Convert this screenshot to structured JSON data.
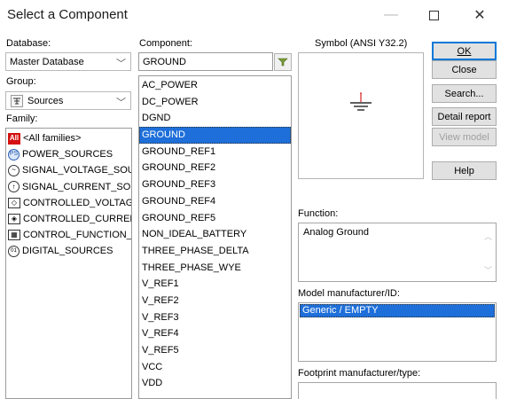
{
  "window": {
    "title": "Select a Component"
  },
  "database": {
    "label": "Database:",
    "value": "Master Database"
  },
  "group": {
    "label": "Group:",
    "value": "Sources"
  },
  "family": {
    "label": "Family:",
    "items": [
      {
        "label": "<All families>",
        "icon": "all-families-icon"
      },
      {
        "label": "POWER_SOURCES",
        "icon": "power-sources-icon"
      },
      {
        "label": "SIGNAL_VOLTAGE_SOU",
        "icon": "signal-voltage-icon"
      },
      {
        "label": "SIGNAL_CURRENT_SOU",
        "icon": "signal-current-icon"
      },
      {
        "label": "CONTROLLED_VOLTAGE",
        "icon": "controlled-voltage-icon"
      },
      {
        "label": "CONTROLLED_CURRENT",
        "icon": "controlled-current-icon"
      },
      {
        "label": "CONTROL_FUNCTION_E",
        "icon": "control-function-icon"
      },
      {
        "label": "DIGITAL_SOURCES",
        "icon": "digital-sources-icon"
      }
    ]
  },
  "component": {
    "label": "Component:",
    "search_value": "GROUND",
    "selected": "GROUND",
    "items": [
      "AC_POWER",
      "DC_POWER",
      "DGND",
      "GROUND",
      "GROUND_REF1",
      "GROUND_REF2",
      "GROUND_REF3",
      "GROUND_REF4",
      "GROUND_REF5",
      "NON_IDEAL_BATTERY",
      "THREE_PHASE_DELTA",
      "THREE_PHASE_WYE",
      "V_REF1",
      "V_REF2",
      "V_REF3",
      "V_REF4",
      "V_REF5",
      "VCC",
      "VDD"
    ]
  },
  "symbol": {
    "label": "Symbol (ANSI Y32.2)"
  },
  "buttons": {
    "ok": "OK",
    "close": "Close",
    "search": "Search...",
    "detail_report": "Detail report",
    "view_model": "View model",
    "help": "Help"
  },
  "function": {
    "label": "Function:",
    "value": "Analog Ground"
  },
  "model_manufacturer": {
    "label": "Model manufacturer/ID:",
    "value": "Generic / EMPTY"
  },
  "footprint": {
    "label": "Footprint manufacturer/type:"
  },
  "colors": {
    "selection": "#1e6fd9",
    "default_button_border": "#0078d7",
    "ground_symbol_red": "#d42020"
  }
}
